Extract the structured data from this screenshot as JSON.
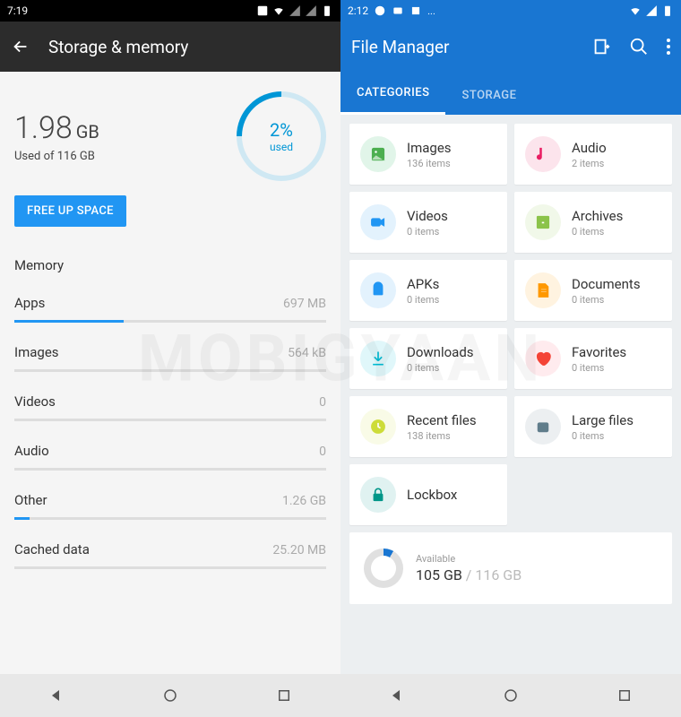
{
  "watermark": "MOBIGYAAN",
  "left": {
    "status_time": "7:19",
    "title": "Storage & memory",
    "used_value": "1.98",
    "used_unit": "GB",
    "used_sub": "Used of 116 GB",
    "pct": "2%",
    "pct_label": "used",
    "free_btn": "FREE UP SPACE",
    "memory_header": "Memory",
    "rows": [
      {
        "label": "Apps",
        "value": "697 MB",
        "fill": 35
      },
      {
        "label": "Images",
        "value": "564 kB",
        "fill": 0
      },
      {
        "label": "Videos",
        "value": "0",
        "fill": 0
      },
      {
        "label": "Audio",
        "value": "0",
        "fill": 0
      },
      {
        "label": "Other",
        "value": "1.26 GB",
        "fill": 5
      },
      {
        "label": "Cached data",
        "value": "25.20 MB",
        "fill": 0
      }
    ]
  },
  "right": {
    "status_time": "2:12",
    "title": "File Manager",
    "tabs": {
      "categories": "CATEGORIES",
      "storage": "STORAGE"
    },
    "cards": [
      {
        "name": "images",
        "title": "Images",
        "sub": "136 items",
        "bg": "#e1f5e9",
        "fg": "#4caf50",
        "icon": "image"
      },
      {
        "name": "audio",
        "title": "Audio",
        "sub": "2 items",
        "bg": "#fce4ec",
        "fg": "#e91e63",
        "icon": "music"
      },
      {
        "name": "videos",
        "title": "Videos",
        "sub": "0 items",
        "bg": "#e3f2fd",
        "fg": "#2196f3",
        "icon": "video"
      },
      {
        "name": "archives",
        "title": "Archives",
        "sub": "0 items",
        "bg": "#f1f8e9",
        "fg": "#8bc34a",
        "icon": "archive"
      },
      {
        "name": "apks",
        "title": "APKs",
        "sub": "0 items",
        "bg": "#e3f2fd",
        "fg": "#2196f3",
        "icon": "android"
      },
      {
        "name": "documents",
        "title": "Documents",
        "sub": "0 items",
        "bg": "#fff3e0",
        "fg": "#ff9800",
        "icon": "doc"
      },
      {
        "name": "downloads",
        "title": "Downloads",
        "sub": "0 items",
        "bg": "#e0f7fa",
        "fg": "#00bcd4",
        "icon": "download"
      },
      {
        "name": "favorites",
        "title": "Favorites",
        "sub": "0 items",
        "bg": "#ffebee",
        "fg": "#f44336",
        "icon": "heart"
      },
      {
        "name": "recent",
        "title": "Recent files",
        "sub": "138 items",
        "bg": "#f9fbe7",
        "fg": "#cddc39",
        "icon": "clock"
      },
      {
        "name": "large",
        "title": "Large files",
        "sub": "0 items",
        "bg": "#eceff1",
        "fg": "#607d8b",
        "icon": "large"
      },
      {
        "name": "lockbox",
        "title": "Lockbox",
        "sub": "",
        "bg": "#e0f2f1",
        "fg": "#009688",
        "icon": "lock"
      }
    ],
    "avail_label": "Available",
    "avail_free": "105 GB",
    "avail_total": "116 GB"
  }
}
